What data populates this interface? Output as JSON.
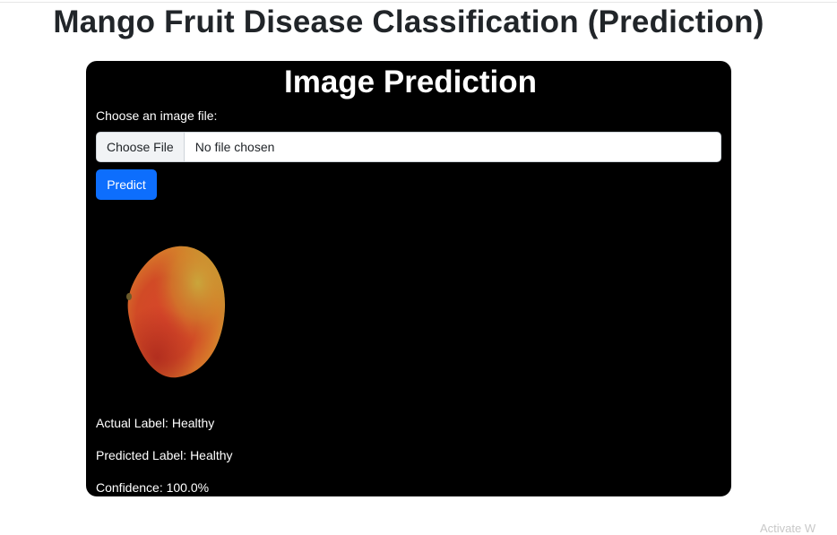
{
  "page": {
    "title": "Mango Fruit Disease Classification (Prediction)"
  },
  "card": {
    "title": "Image Prediction",
    "file_label": "Choose an image file:",
    "choose_file_button": "Choose File",
    "file_status": "No file chosen",
    "predict_button": "Predict"
  },
  "results": {
    "actual": "Actual Label: Healthy",
    "predicted": "Predicted Label: Healthy",
    "confidence": "Confidence: 100.0%"
  },
  "preview_image": {
    "subject": "mango-fruit-image"
  },
  "watermark": "Activate W",
  "colors": {
    "card_background": "#000000",
    "primary_button": "#0d6efd"
  }
}
